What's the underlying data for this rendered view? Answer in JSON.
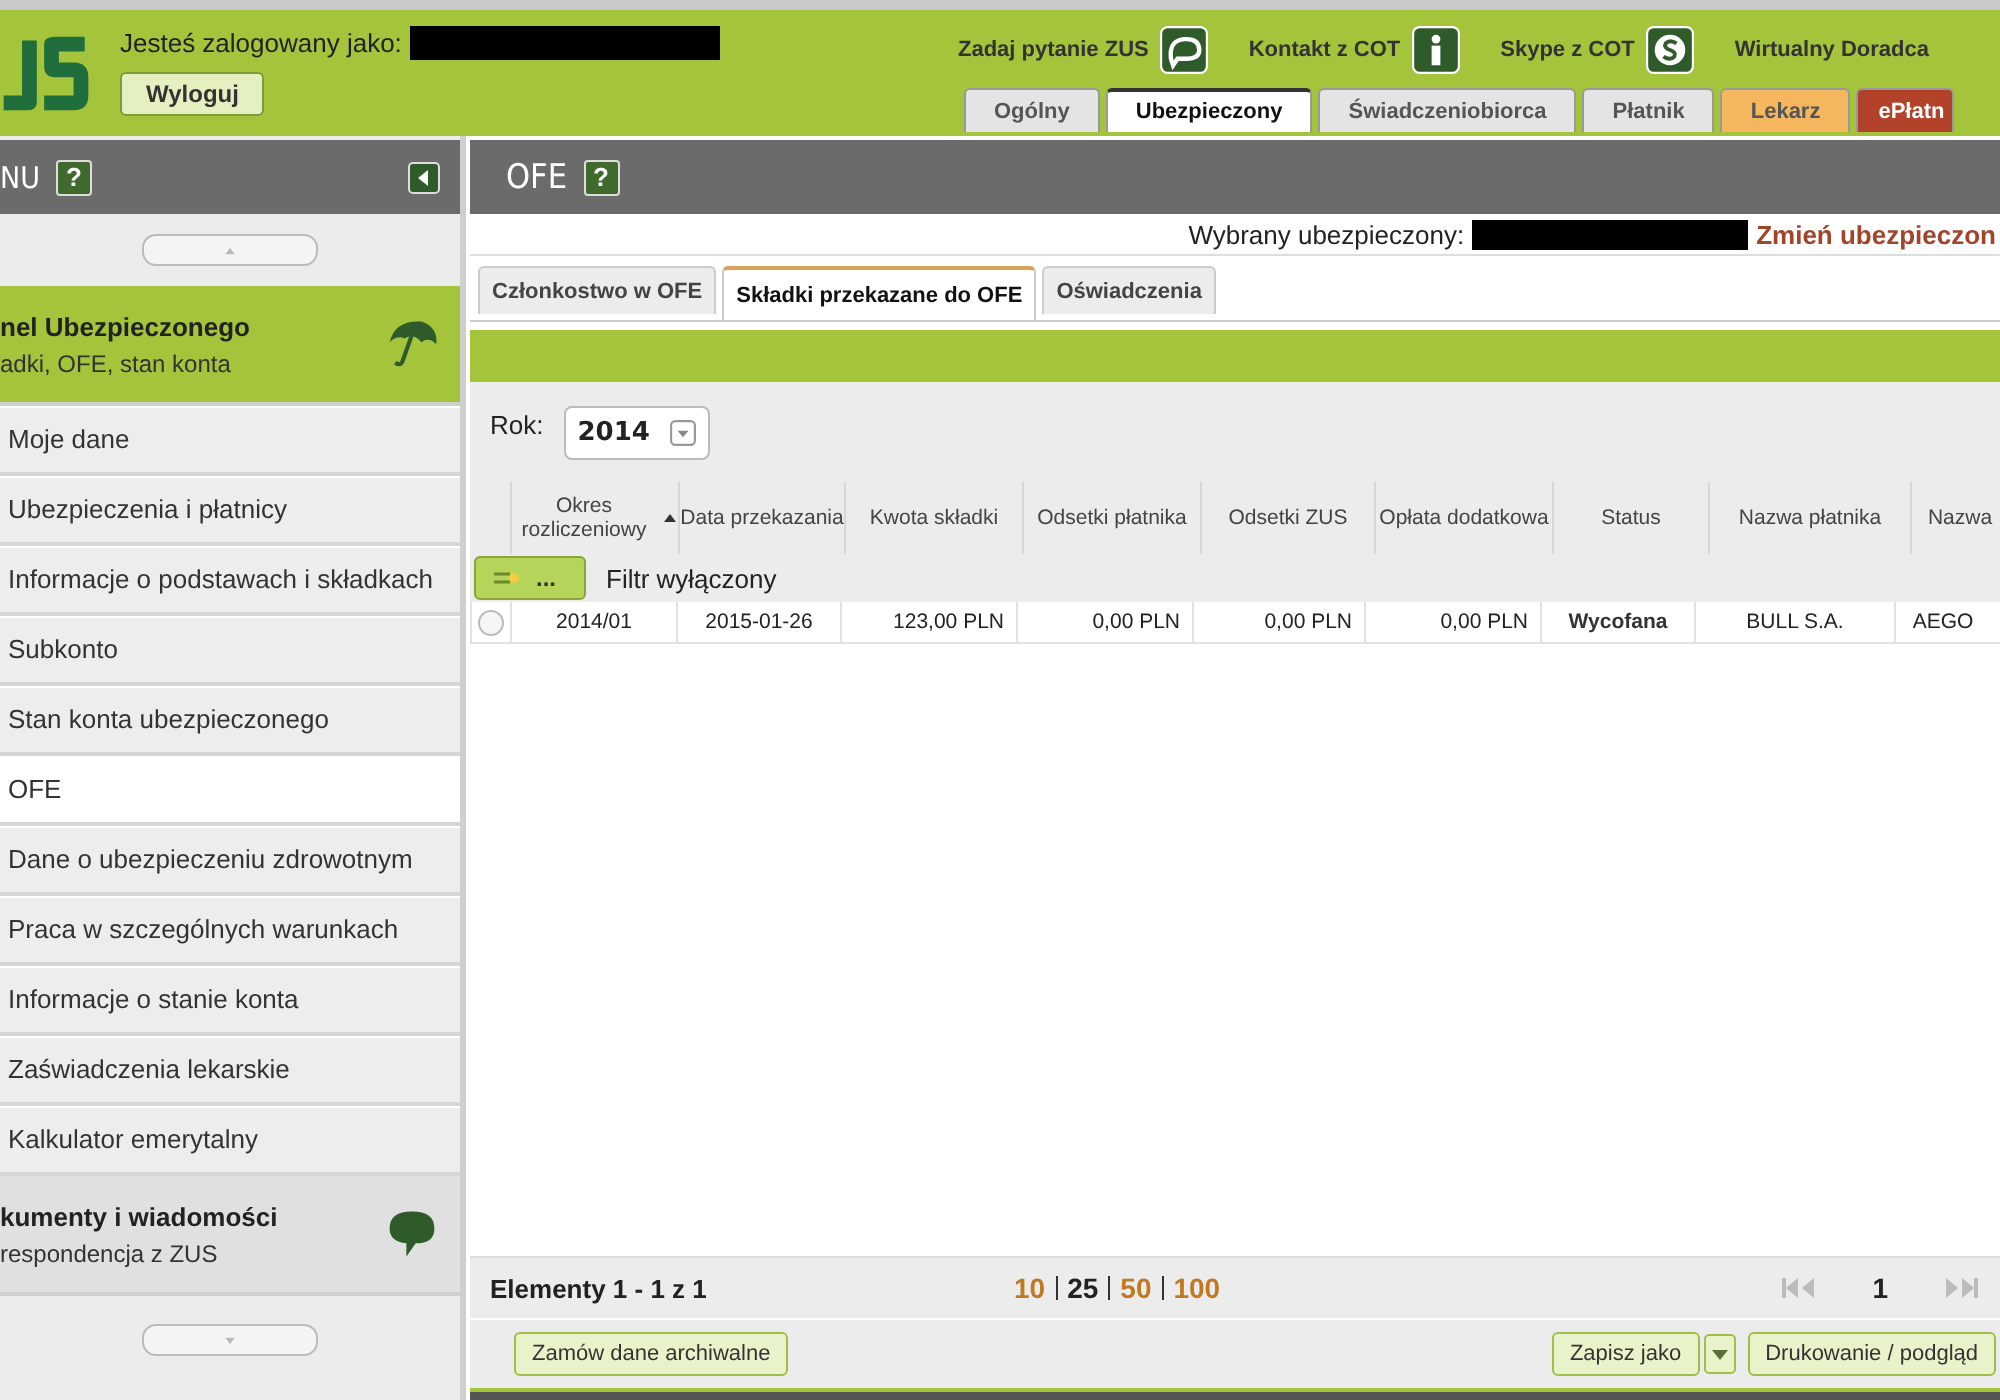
{
  "header": {
    "logged_in_label": "Jesteś zalogowany jako:",
    "logout_button": "Wyloguj",
    "links": [
      {
        "label": "Zadaj pytanie ZUS",
        "kind": "chat"
      },
      {
        "label": "Kontakt z COT",
        "kind": "info"
      },
      {
        "label": "Skype z COT",
        "kind": "skype"
      },
      {
        "label": "Wirtualny Doradca",
        "kind": "none"
      }
    ],
    "tabs": [
      {
        "label": "Ogólny",
        "selected": false,
        "color": "#e4e4e4"
      },
      {
        "label": "Ubezpieczony",
        "selected": true,
        "color": "#ffffff"
      },
      {
        "label": "Świadczeniobiorca",
        "selected": false,
        "color": "#e4e4e4"
      },
      {
        "label": "Płatnik",
        "selected": false,
        "color": "#e4e4e4"
      },
      {
        "label": "Lekarz",
        "selected": false,
        "color": "#f6b65e"
      },
      {
        "label": "ePłatn",
        "selected": false,
        "color": "#b2432a"
      }
    ]
  },
  "sidebar": {
    "title": "NU",
    "help": "?",
    "top_panel": {
      "title": "nel Ubezpieczonego",
      "subtitle": "adki, OFE, stan konta",
      "highlighted": true
    },
    "items": [
      {
        "label": "Moje dane",
        "selected": false
      },
      {
        "label": "Ubezpieczenia i płatnicy",
        "selected": false
      },
      {
        "label": "Informacje o podstawach i składkach",
        "selected": false
      },
      {
        "label": "Subkonto",
        "selected": false
      },
      {
        "label": "Stan konta ubezpieczonego",
        "selected": false
      },
      {
        "label": "OFE",
        "selected": true
      },
      {
        "label": "Dane o ubezpieczeniu zdrowotnym",
        "selected": false
      },
      {
        "label": "Praca w szczególnych warunkach",
        "selected": false
      },
      {
        "label": "Informacje o stanie konta",
        "selected": false
      },
      {
        "label": "Zaświadczenia lekarskie",
        "selected": false
      },
      {
        "label": "Kalkulator emerytalny",
        "selected": false
      }
    ],
    "bottom_panel": {
      "title": "kumenty i wiadomości",
      "subtitle": "respondencja z ZUS",
      "highlighted": false
    }
  },
  "main": {
    "title": "OFE",
    "help": "?",
    "selected_label": "Wybrany ubezpieczony:",
    "change_link": "Zmień ubezpieczon",
    "subtabs": [
      {
        "label": "Członkostwo w OFE",
        "selected": false
      },
      {
        "label": "Składki przekazane do OFE",
        "selected": true
      },
      {
        "label": "Oświadczenia",
        "selected": false
      }
    ],
    "year_label": "Rok:",
    "year_value": "2014",
    "table": {
      "columns": [
        {
          "label": "Okres rozliczeniowy",
          "sorted": true
        },
        {
          "label": "Data przekazania",
          "sorted": false
        },
        {
          "label": "Kwota składki",
          "sorted": false
        },
        {
          "label": "Odsetki płatnika",
          "sorted": false
        },
        {
          "label": "Odsetki ZUS",
          "sorted": false
        },
        {
          "label": "Opłata dodatkowa",
          "sorted": false
        },
        {
          "label": "Status",
          "sorted": false
        },
        {
          "label": "Nazwa płatnika",
          "sorted": false
        },
        {
          "label": "Nazwa",
          "sorted": false
        }
      ],
      "filter_button": "...",
      "filter_label": "Filtr wyłączony",
      "rows": [
        {
          "selected": false,
          "cells": [
            "2014/01",
            "2015-01-26",
            "123,00 PLN",
            "0,00 PLN",
            "0,00 PLN",
            "0,00 PLN",
            "Wycofana",
            "BULL S.A.",
            "AEGO"
          ]
        }
      ]
    },
    "pager": {
      "summary": "Elementy 1 - 1 z 1",
      "page_sizes": [
        {
          "label": "10",
          "selected": false
        },
        {
          "label": "25",
          "selected": true
        },
        {
          "label": "50",
          "selected": false
        },
        {
          "label": "100",
          "selected": false
        }
      ],
      "page": "1"
    },
    "buttons": {
      "archive": "Zamów dane archiwalne",
      "save": "Zapisz jako",
      "print": "Drukowanie / podgląd"
    }
  }
}
